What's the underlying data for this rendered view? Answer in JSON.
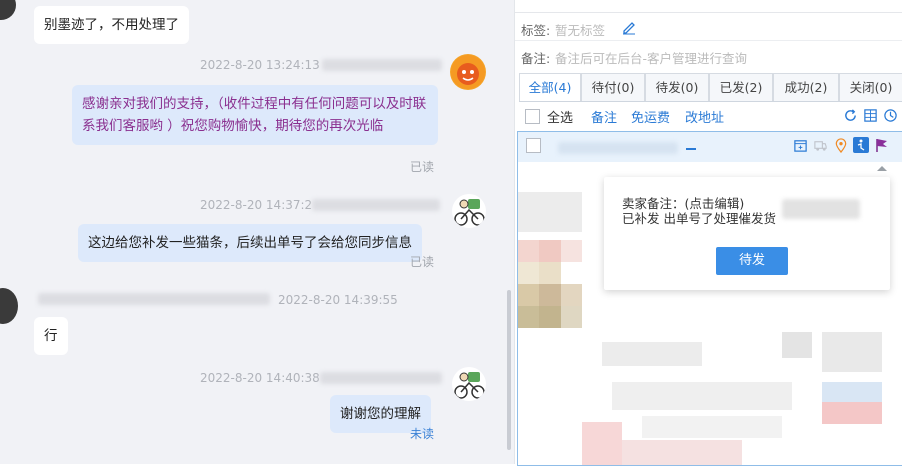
{
  "chat": {
    "messages": [
      {
        "text": "别墨迹了，不用处理了"
      },
      {
        "timestamp": "2022-8-20 13:24:13",
        "text": "感谢亲对我们的支持，（收件过程中有任何问题可以及时联系我们客服哟 ）祝您购物愉快，期待您的再次光临",
        "status": "已读"
      },
      {
        "timestamp": "2022-8-20 14:37:2",
        "text": "这边给您补发一些猫条，后续出单号了会给您同步信息",
        "status": "已读"
      },
      {
        "timestamp": "2022-8-20 14:39:55",
        "text": "行"
      },
      {
        "timestamp": "2022-8-20 14:40:38",
        "text": "谢谢您的理解",
        "status": "未读"
      }
    ]
  },
  "panel": {
    "tag_label": "标签:",
    "tag_value": "暂无标签",
    "note_label": "备注:",
    "note_placeholder": "备注后可在后台-客户管理进行查询",
    "tabs": [
      "全部(4)",
      "待付(0)",
      "待发(0)",
      "已发(2)",
      "成功(2)",
      "关闭(0)"
    ],
    "toolbar": {
      "select_all": "全选",
      "remark": "备注",
      "free_shipping": "免运费",
      "change_address": "改地址"
    },
    "popup": {
      "seller_note": "卖家备注：(点击编辑)",
      "note_text": "已补发 出单号了处理催发货",
      "button": "待发"
    }
  },
  "colors": {
    "accent": "#2a7ad5",
    "bubble_out": "#dde9fb",
    "message_purple": "#8a2f8f"
  }
}
